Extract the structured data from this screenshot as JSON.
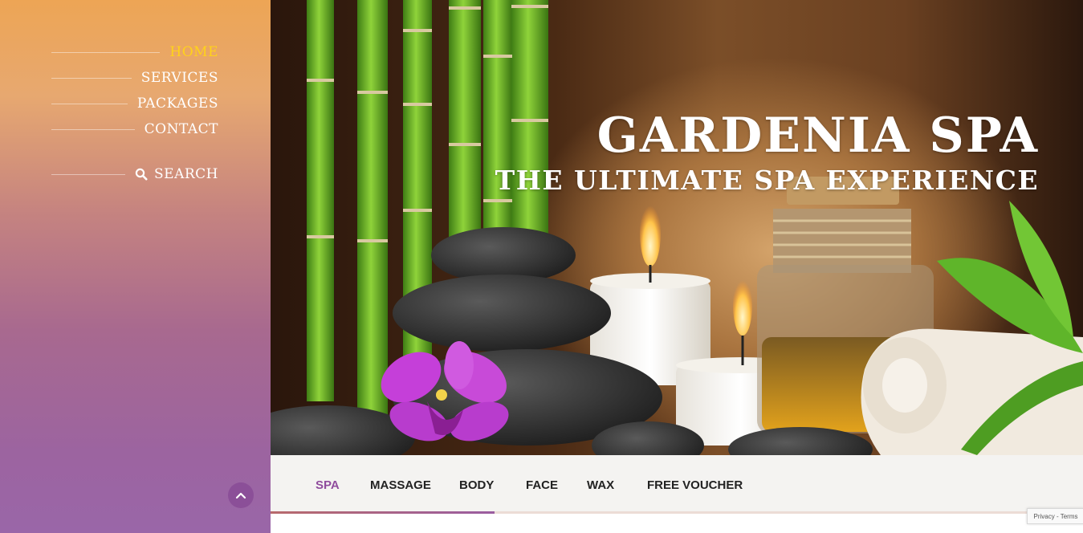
{
  "sidebar": {
    "nav": [
      {
        "label": "HOME",
        "active": true
      },
      {
        "label": "SERVICES",
        "active": false
      },
      {
        "label": "PACKAGES",
        "active": false
      },
      {
        "label": "CONTACT",
        "active": false
      }
    ],
    "search_label": "SEARCH",
    "icons": {
      "search": "search-icon",
      "scroll_top": "chevron-up-icon"
    }
  },
  "hero": {
    "title": "GARDENIA SPA",
    "subtitle": "THE ULTIMATE SPA EXPERIENCE"
  },
  "tabs": [
    {
      "label": "SPA",
      "active": true
    },
    {
      "label": "MASSAGE",
      "active": false
    },
    {
      "label": "BODY",
      "active": false
    },
    {
      "label": "FACE",
      "active": false
    },
    {
      "label": "WAX",
      "active": false
    },
    {
      "label": "FREE VOUCHER",
      "active": false
    }
  ],
  "recaptcha": {
    "text": "Privacy - Terms"
  },
  "colors": {
    "accent": "#8f4c9d",
    "active_nav": "#ffd21a"
  }
}
